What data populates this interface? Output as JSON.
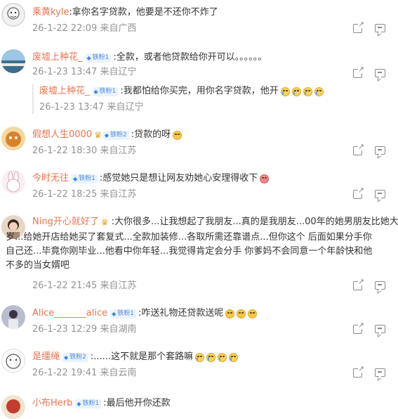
{
  "comments": [
    {
      "username": "乘黄kyle",
      "text": ":拿你名字贷款，他要是不还你不炸了",
      "time": "26-1-22 22:09",
      "location": "来自广西",
      "avatar_color": "#e6e6e6"
    },
    {
      "username": "废墟上种花_",
      "fan_badge": "铁粉1",
      "text": ":全款，或者他贷款给你开可以。。。。。。",
      "time": "26-1-23 13:47",
      "location": "来自辽宁",
      "avatar_color": "#6fa3c9",
      "reply": {
        "username": "废墟上种花_",
        "fan_badge": "铁粉1",
        "text": ":我都怕给你买完，用你名字贷款，他开",
        "time": "26-1-23 13:47",
        "location": "来自辽宁"
      }
    },
    {
      "username": "假想人生0000",
      "fan_badge": "铁粉2",
      "text": ":贷款的呀",
      "time": "26-1-22 18:30",
      "location": "来自江苏",
      "avatar_color": "#e0a050"
    },
    {
      "username": "今时无往",
      "fan_badge": "铁粉1",
      "text": ":感觉她只是想让网友劝她心安理得收下",
      "time": "26-1-22 18:25",
      "location": "来自江苏",
      "avatar_color": "#f2dfe8"
    },
    {
      "username": "Ning开心就好了",
      "text_lines": [
        ":大你很多...让我想起了我朋友...真的是我朋友...00年的她男朋友比她大",
        "岁...给她开店给她买了套复式...全款加装修...各取所需还靠谱点...但你这个 后面如果分手你",
        "自己还...毕竟你刚毕业...他看中你年轻...我觉得肯定会分手 你爹妈不会同意一个年龄快和他",
        "不多的当女婿吧"
      ],
      "time": "26-1-22 21:45",
      "location": "来自江苏",
      "avatar_color": "#c9a58a"
    },
    {
      "username": "Alice_______alice",
      "fan_badge": "铁粉1",
      "text": ":咋送礼物还贷款送呢",
      "time": "26-1-23 12:29",
      "location": "来自湖南",
      "avatar_color": "#8a8fa8"
    },
    {
      "username": "是缰绳",
      "fan_badge": "铁粉2",
      "text": ":......这不就是那个套路嘛",
      "time": "26-1-22 19:41",
      "location": "来自云南",
      "avatar_color": "#f4f4f4"
    },
    {
      "username": "小布Herb",
      "fan_badge": "铁粉1",
      "text": ":最后他开你还款",
      "avatar_color": "#c53d2e"
    }
  ],
  "colors": {
    "username": "#eb7350",
    "meta": "#939393",
    "badge_bg": "#eaf3fd",
    "badge_text": "#4d8be0"
  },
  "icons": {
    "share": "share-icon",
    "comment": "comment-icon",
    "fan_badge": "diamond-icon",
    "crown": "crown-icon"
  }
}
